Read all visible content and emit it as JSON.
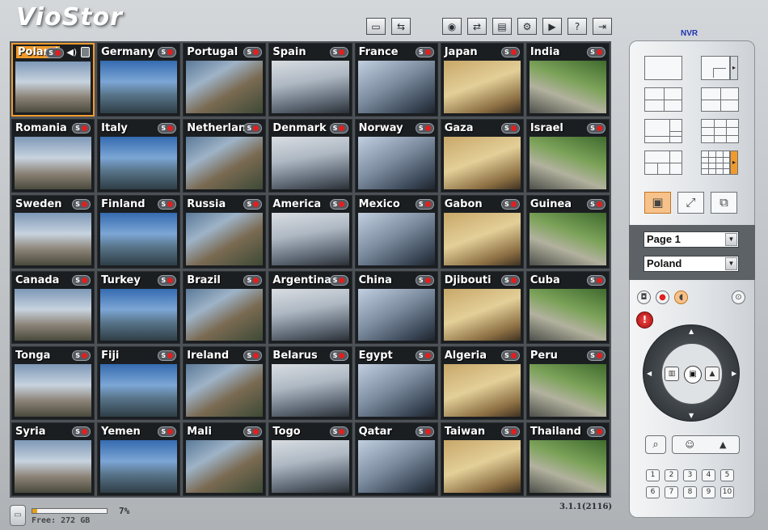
{
  "app": {
    "logo": "VioStor",
    "nvr_label": "NVR",
    "version": "3.1.1(2116)"
  },
  "toolbar": [
    {
      "name": "monitor-icon",
      "glyph": "▭"
    },
    {
      "name": "multi-server-icon",
      "glyph": "⇆"
    },
    {
      "name": "remote-config-icon",
      "glyph": "◉"
    },
    {
      "name": "network-icon",
      "glyph": "⇄"
    },
    {
      "name": "record-settings-icon",
      "glyph": "▤"
    },
    {
      "name": "system-settings-icon",
      "glyph": "⚙"
    },
    {
      "name": "playback-icon",
      "glyph": "▶"
    },
    {
      "name": "help-icon",
      "glyph": "?"
    },
    {
      "name": "logout-icon",
      "glyph": "⇥"
    }
  ],
  "cameras": [
    "Poland",
    "Germany",
    "Portugal",
    "Spain",
    "France",
    "Japan",
    "India",
    "Romania",
    "Italy",
    "Netherlan",
    "Denmark",
    "Norway",
    "Gaza",
    "Israel",
    "Sweden",
    "Finland",
    "Russia",
    "America",
    "Mexico",
    "Gabon",
    "Guinea",
    "Canada",
    "Turkey",
    "Brazil",
    "Argentina",
    "China",
    "Djibouti",
    "Cuba",
    "Tonga",
    "Fiji",
    "Ireland",
    "Belarus",
    "Egypt",
    "Algeria",
    "Peru",
    "Syria",
    "Yemen",
    "Mali",
    "Togo",
    "Qatar",
    "Taiwan",
    "Thailand"
  ],
  "active_camera": "Poland",
  "rec_badge": "S",
  "storage": {
    "used_percent_label": "7%",
    "used_fraction": 0.07,
    "free_label": "Free: 272 GB"
  },
  "panel": {
    "page_select": "Page 1",
    "camera_select": "Poland"
  },
  "colors": {
    "accent": "#f19a2c",
    "record": "#e02020",
    "nvr": "#1d33b6"
  },
  "numpad": [
    "1",
    "2",
    "3",
    "4",
    "5",
    "6",
    "7",
    "8",
    "9",
    "10"
  ]
}
